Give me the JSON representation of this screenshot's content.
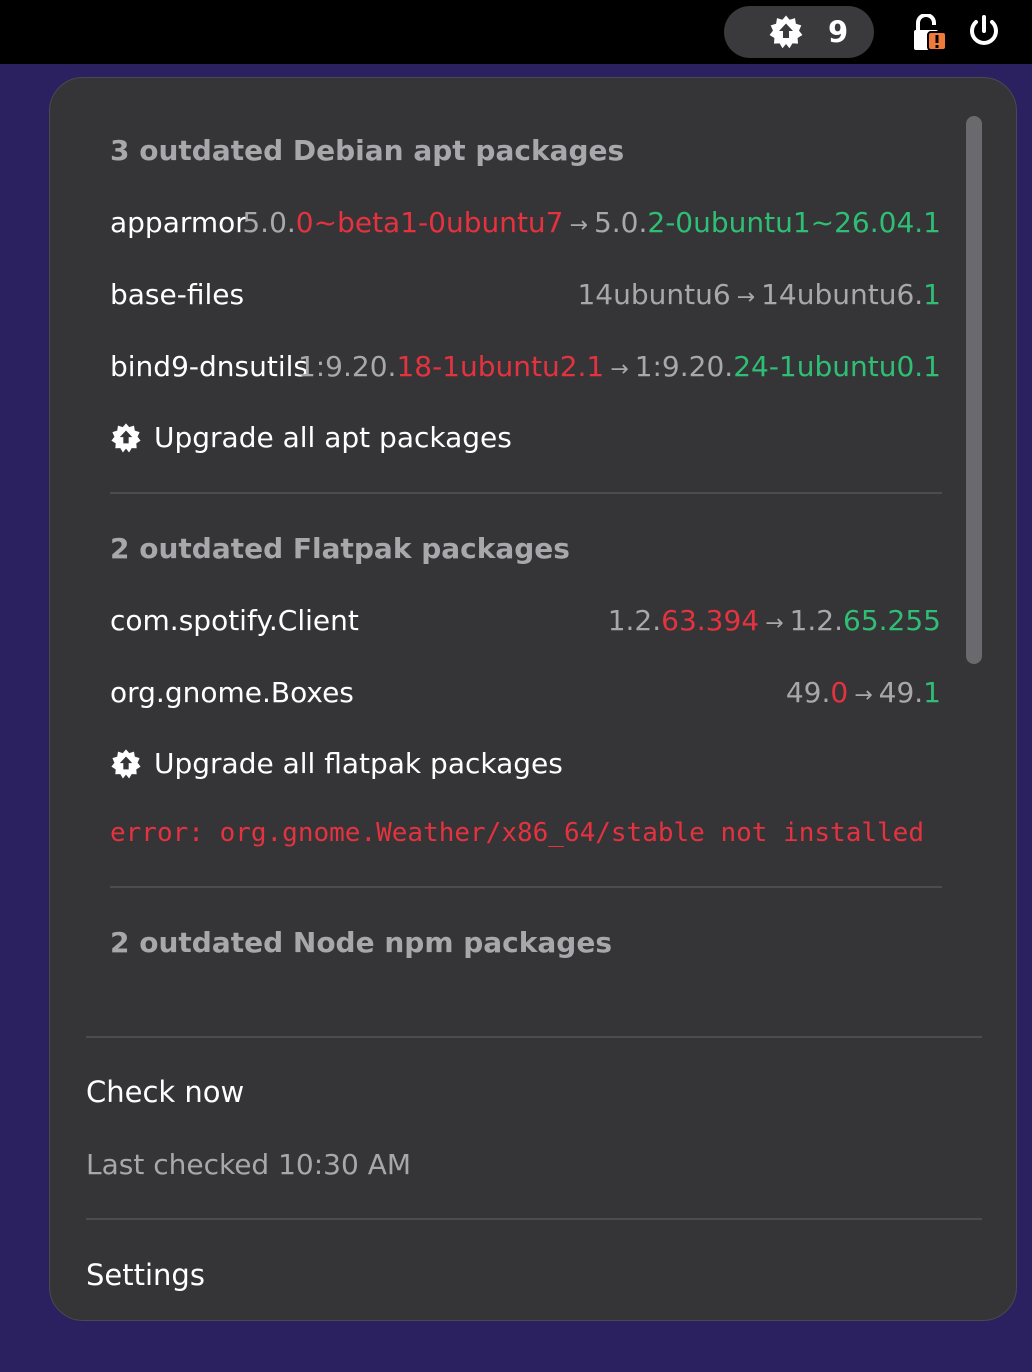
{
  "topbar": {
    "update_count": "9",
    "icons": [
      "update-gear-icon",
      "lock-icon",
      "power-icon"
    ],
    "accent_warning": "#f07a3a"
  },
  "apt": {
    "heading": "3 outdated Debian apt packages",
    "packages": [
      {
        "name": "apparmor",
        "common": "5.0.",
        "old": "0~beta1-0ubuntu7",
        "new_common": "5.0.",
        "new": "2-0ubuntu1~26.04.1"
      },
      {
        "name": "base-files",
        "common": "14ubuntu6",
        "old": "",
        "new_common": "14ubuntu6.",
        "new": "1"
      },
      {
        "name": "bind9-dnsutils",
        "common": "1:9.20.",
        "old": "18-1ubuntu2.1",
        "new_common": "1:9.20.",
        "new": "24-1ubuntu0.1"
      }
    ],
    "upgrade_label": "Upgrade all apt packages"
  },
  "flatpak": {
    "heading": "2 outdated Flatpak packages",
    "packages": [
      {
        "name": "com.spotify.Client",
        "common": "1.2.",
        "old": "63.394",
        "new_common": "1.2.",
        "new": "65.255"
      },
      {
        "name": "org.gnome.Boxes",
        "common": "49.",
        "old": "0",
        "new_common": "49.",
        "new": "1"
      }
    ],
    "upgrade_label": "Upgrade all flatpak packages",
    "error": "error: org.gnome.Weather/x86_64/stable not installed"
  },
  "npm": {
    "heading": "2 outdated Node npm packages"
  },
  "footer": {
    "check_now": "Check now",
    "last_checked": "Last checked 10:30 AM",
    "settings": "Settings"
  },
  "colors": {
    "old_version": "#e5323f",
    "new_version": "#2fbf74",
    "menu_bg": "#353538",
    "desktop_bg": "#2b2060"
  }
}
